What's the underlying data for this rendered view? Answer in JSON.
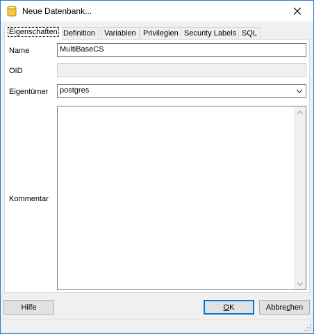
{
  "window": {
    "title": "Neue Datenbank..."
  },
  "tabs": [
    {
      "label": "Eigenschaften"
    },
    {
      "label": "Definition"
    },
    {
      "label": "Variablen"
    },
    {
      "label": "Privilegien"
    },
    {
      "label": "Security Labels"
    },
    {
      "label": "SQL"
    }
  ],
  "form": {
    "name_label": "Name",
    "name_value": "MultiBaseCS",
    "oid_label": "OID",
    "oid_value": "",
    "owner_label": "Eigentümer",
    "owner_value": "postgres",
    "comment_label": "Kommentar",
    "comment_value": ""
  },
  "buttons": {
    "help_label": "Hilfe",
    "ok_label": "OK",
    "cancel_label_pre": "Abbre",
    "cancel_label_u": "c",
    "cancel_label_post": "hen",
    "ok_label_u": "O",
    "ok_label_post": "K"
  },
  "colors": {
    "accent": "#0078d7",
    "window_border": "#2b79d0",
    "panel_bg": "#ffffff",
    "chrome_bg": "#f0f0f0"
  },
  "icons": {
    "app": "database-icon",
    "close": "close-icon",
    "dropdown": "chevron-down-icon"
  }
}
